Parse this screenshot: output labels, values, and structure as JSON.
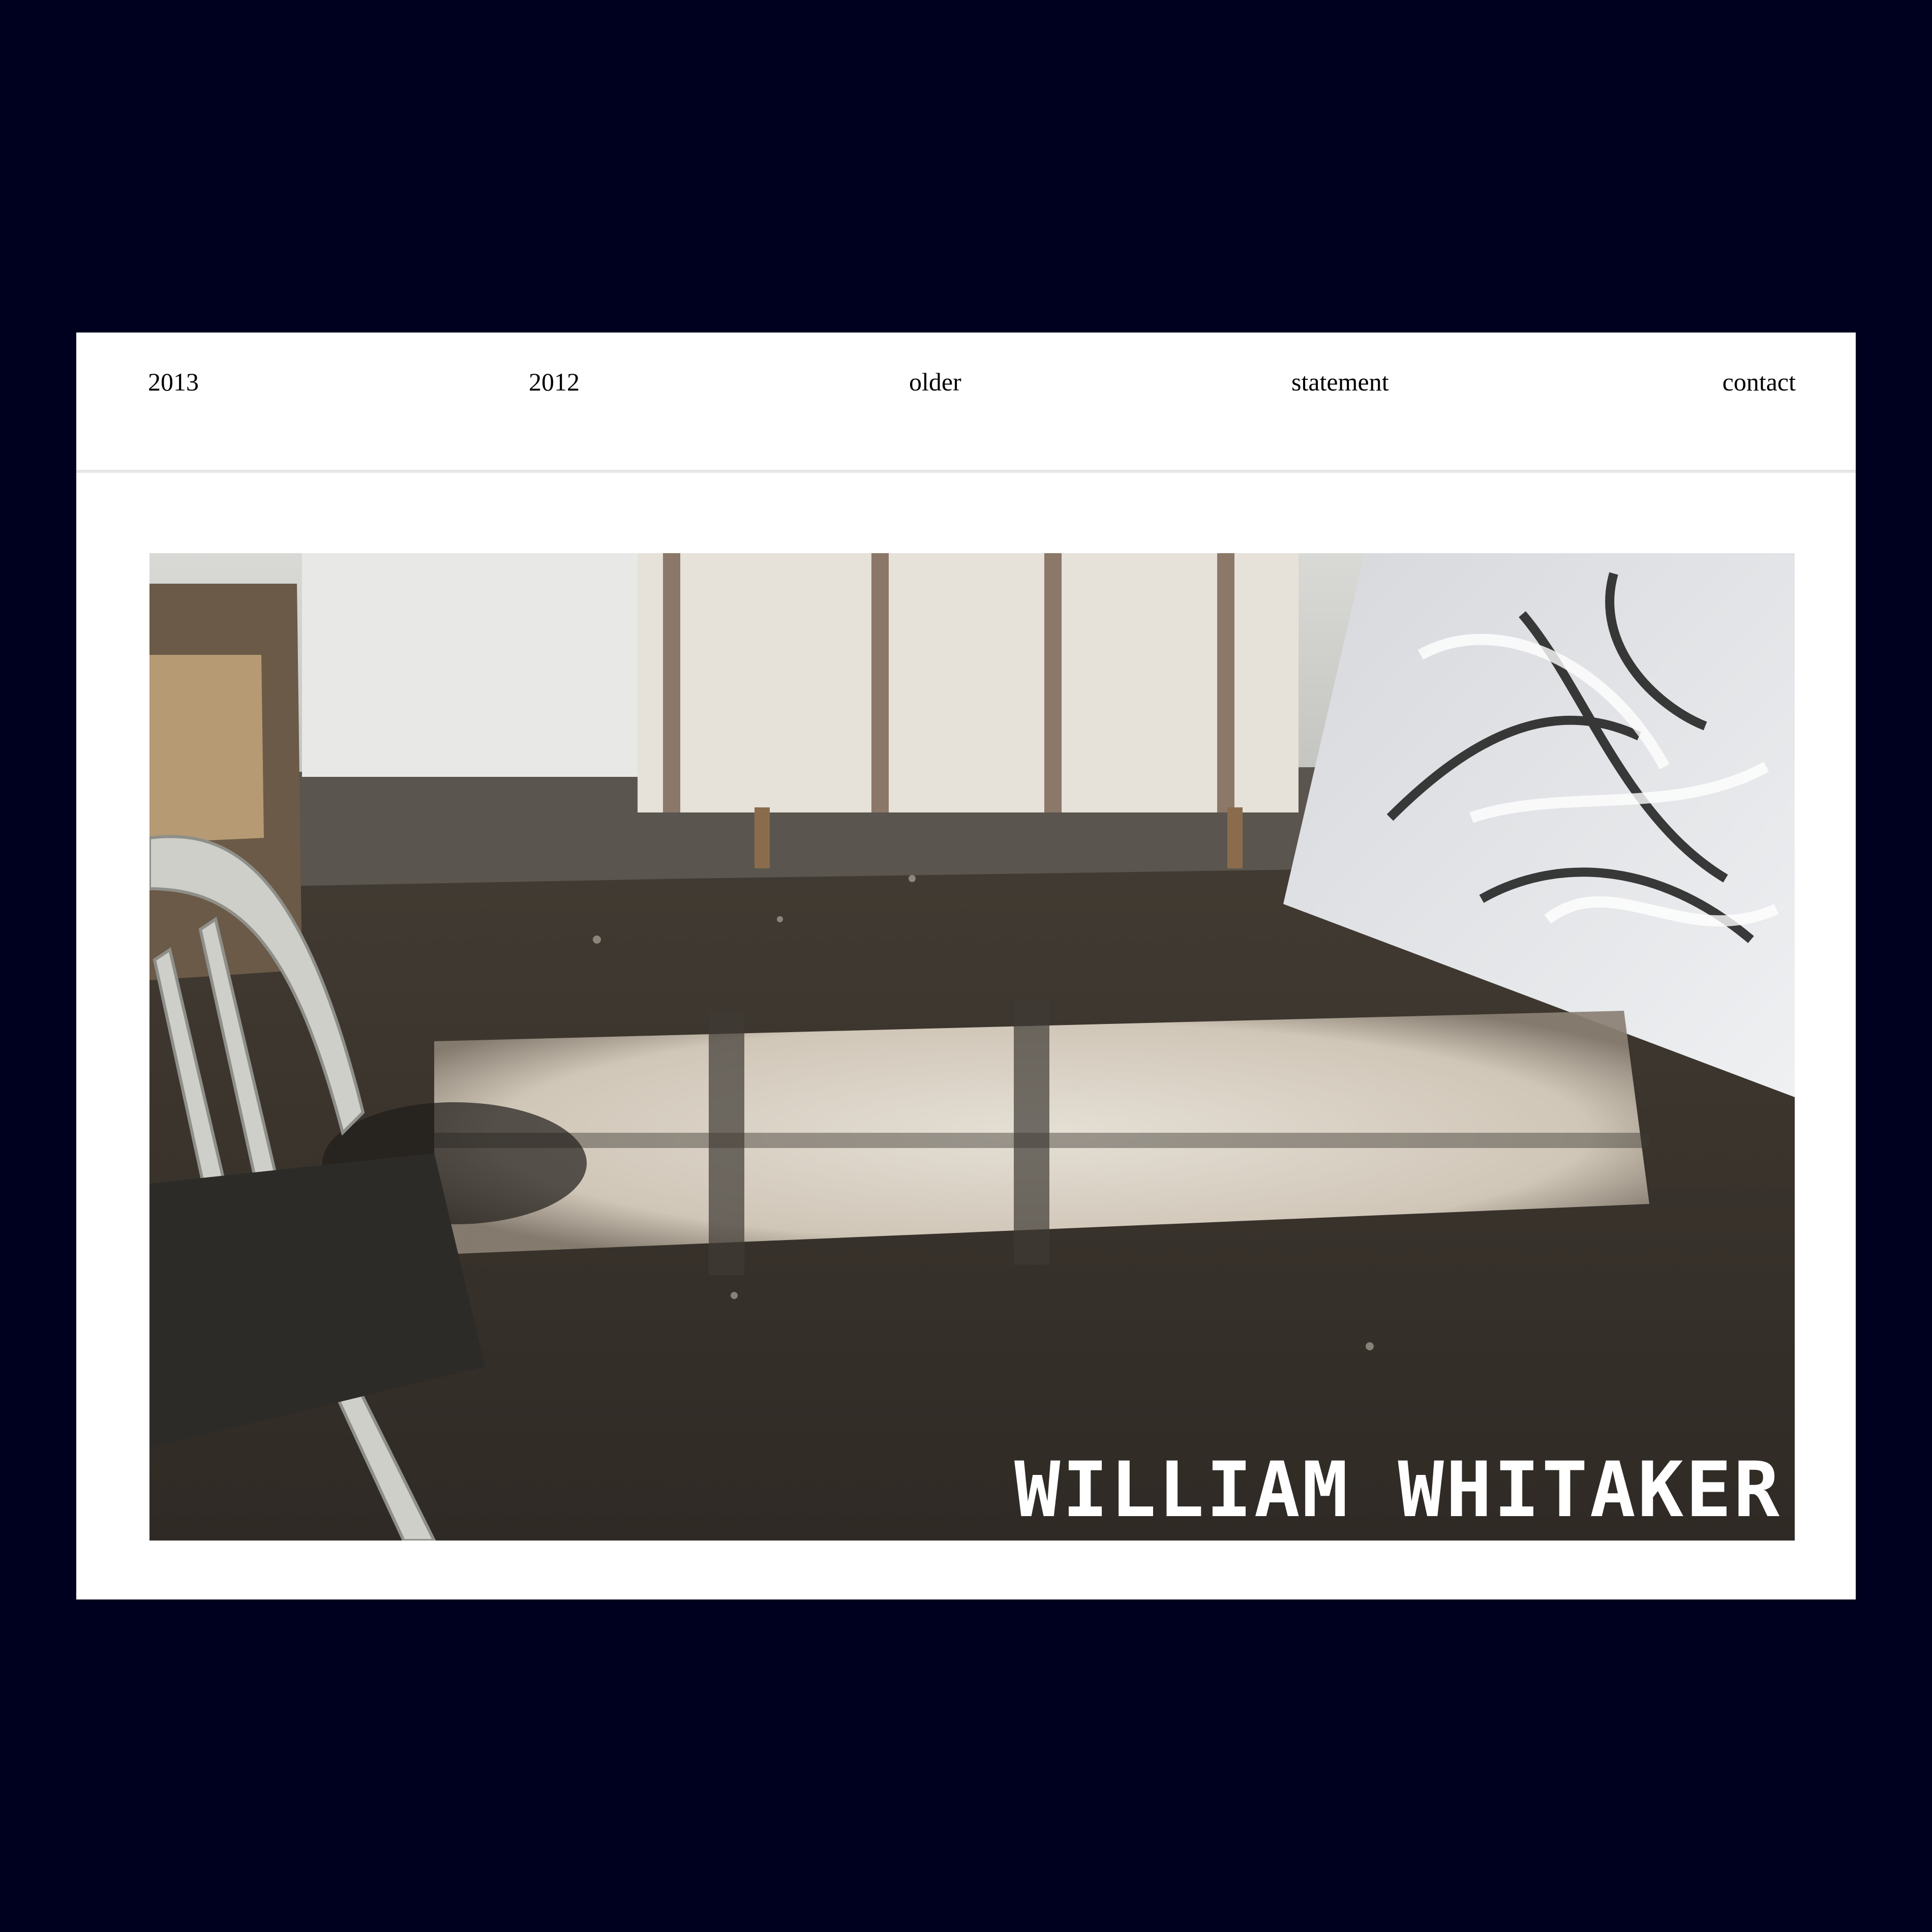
{
  "nav": {
    "items": [
      {
        "label": "2013"
      },
      {
        "label": "2012"
      },
      {
        "label": "older"
      },
      {
        "label": "statement"
      },
      {
        "label": "contact"
      }
    ]
  },
  "hero": {
    "title": "WILLIAM WHITAKER",
    "title_color": "#ffffff"
  },
  "colors": {
    "background": "#00001f",
    "page": "#ffffff",
    "divider": "#e6e6e6",
    "text": "#000000"
  }
}
